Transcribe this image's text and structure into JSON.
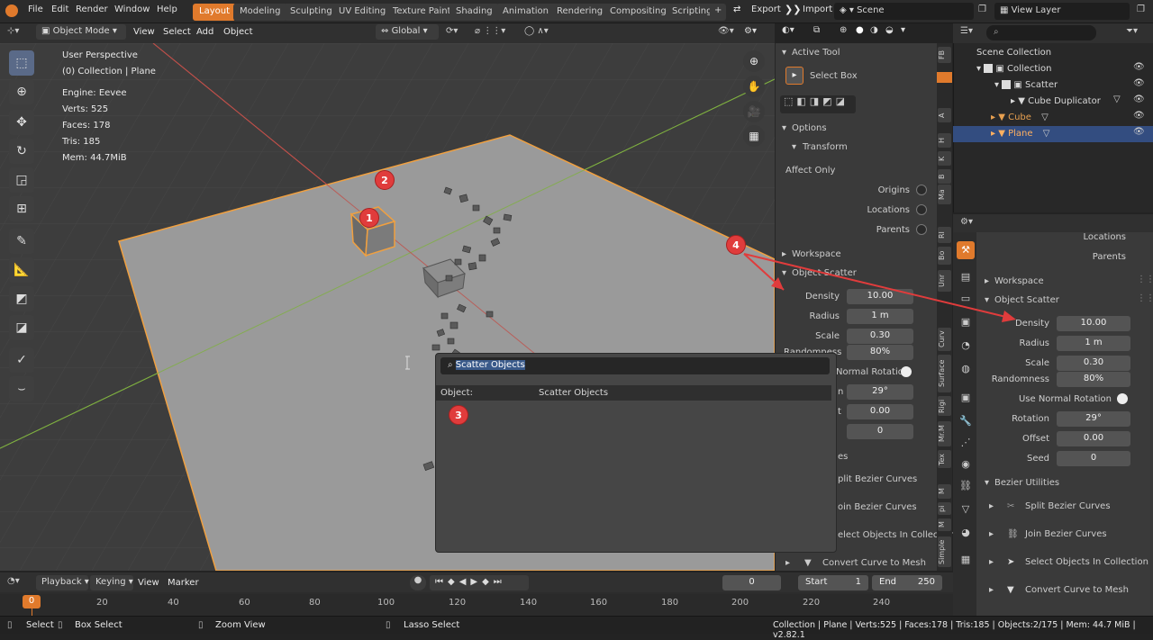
{
  "menubar": {
    "items": [
      "File",
      "Edit",
      "Render",
      "Window",
      "Help"
    ],
    "workspaces": [
      "Layout",
      "Modeling",
      "Sculpting",
      "UV Editing",
      "Texture Paint",
      "Shading",
      "Animation",
      "Rendering",
      "Compositing",
      "Scripting"
    ],
    "add_tab": "+",
    "export": "Export",
    "import": "Import",
    "scene": "Scene",
    "view_layer": "View Layer"
  },
  "viewport_header": {
    "mode": "Object Mode",
    "menus": [
      "View",
      "Select",
      "Add",
      "Object"
    ],
    "orientation": "Global"
  },
  "overlay": {
    "perspective": "User Perspective",
    "collection": "(0) Collection | Plane",
    "engine": "Engine: Eevee",
    "verts": "Verts: 525",
    "faces": "Faces: 178",
    "tris": "Tris: 185",
    "mem": "Mem: 44.7MiB"
  },
  "npanel": {
    "active_tool": "Active Tool",
    "select_box": "Select Box",
    "options": "Options",
    "transform": "Transform",
    "affect_only": "Affect Only",
    "origins": "Origins",
    "locations": "Locations",
    "parents": "Parents",
    "workspace": "Workspace",
    "object_scatter": "Object Scatter",
    "density_label": "Density",
    "density": "10.00",
    "radius_label": "Radius",
    "radius": "1 m",
    "scale_label": "Scale",
    "scale": "0.30",
    "randomness_label": "Randomness",
    "randomness": "80%",
    "normal_rotation": "Normal Rotation",
    "rotation_partial": "n",
    "rotation": "29°",
    "offset_partial": "t",
    "offset": "0.00",
    "seed": "0",
    "bezier_partial": "es",
    "split_partial": "plit Bezier Curves",
    "join_partial": "oin Bezier Curves",
    "select_partial": "elect Objects In Collection",
    "convert": "Convert Curve to Mesh"
  },
  "vtabs": [
    "FB",
    "A",
    "H",
    "K",
    "B",
    "Ma",
    "RI",
    "Bo",
    "Unr",
    "Curv",
    "Surface",
    "Rigi",
    "Mr.M",
    "Tex",
    "M",
    "pi",
    "M",
    "Simple"
  ],
  "outliner": {
    "scene_collection": "Scene Collection",
    "collection": "Collection",
    "scatter": "Scatter",
    "cube_duplicator": "Cube Duplicator",
    "cube": "Cube",
    "plane": "Plane"
  },
  "props": {
    "locations": "Locations",
    "parents": "Parents",
    "workspace": "Workspace",
    "object_scatter": "Object Scatter",
    "density_label": "Density",
    "density": "10.00",
    "radius_label": "Radius",
    "radius": "1 m",
    "scale_label": "Scale",
    "scale": "0.30",
    "randomness_label": "Randomness",
    "randomness": "80%",
    "normal_rotation": "Use Normal Rotation",
    "rotation_label": "Rotation",
    "rotation": "29°",
    "offset_label": "Offset",
    "offset": "0.00",
    "seed_label": "Seed",
    "seed": "0",
    "bezier": "Bezier Utilities",
    "split": "Split Bezier Curves",
    "join": "Join Bezier Curves",
    "select": "Select Objects In Collection",
    "convert": "Convert Curve to Mesh"
  },
  "popup": {
    "search": "Scatter Objects",
    "col_object": "Object:",
    "col_name": "Scatter Objects"
  },
  "markers": [
    "1",
    "2",
    "3",
    "4"
  ],
  "timeline": {
    "playback": "Playback",
    "keying": "Keying",
    "view": "View",
    "marker": "Marker",
    "current": "0",
    "start_label": "Start",
    "start": "1",
    "end_label": "End",
    "end": "250",
    "frame_cursor": "0",
    "ticks": [
      "20",
      "40",
      "60",
      "80",
      "100",
      "120",
      "140",
      "160",
      "180",
      "200",
      "220",
      "240"
    ]
  },
  "status": {
    "select": "Select",
    "box_select": "Box Select",
    "zoom_view": "Zoom View",
    "lasso_select": "Lasso Select",
    "info": "Collection | Plane | Verts:525 | Faces:178 | Tris:185 | Objects:2/175 | Mem: 44.7 MiB | v2.82.1"
  },
  "colors": {
    "accent": "#e07a2c",
    "selection": "#f0a040",
    "marker": "#e03c3c",
    "x_axis": "#c0504a",
    "y_axis": "#7fb040"
  }
}
